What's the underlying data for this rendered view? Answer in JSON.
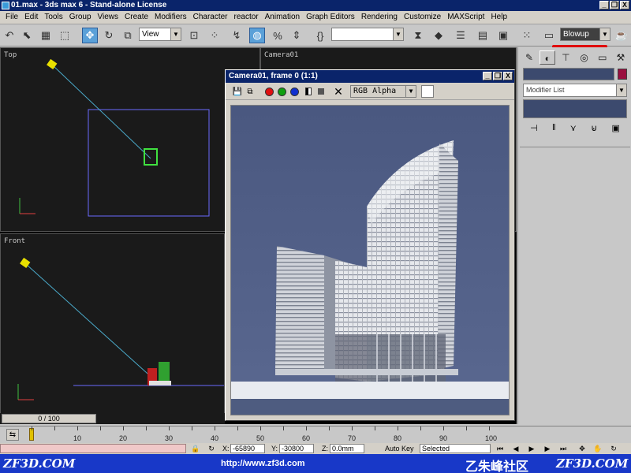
{
  "window": {
    "title": "01.max - 3ds max 6 - Stand-alone License",
    "minimize": "_",
    "restore": "❐",
    "close": "X"
  },
  "menu": [
    "File",
    "Edit",
    "Tools",
    "Group",
    "Views",
    "Create",
    "Modifiers",
    "Character",
    "reactor",
    "Animation",
    "Graph Editors",
    "Rendering",
    "Customize",
    "MAXScript",
    "Help"
  ],
  "toolbar": {
    "reference_coord": "View",
    "selection_set": "",
    "render_type": "Blowup"
  },
  "viewports": {
    "top_label": "Top",
    "front_label": "Front",
    "camera_label": "Camera01"
  },
  "render_window": {
    "title": "Camera01, frame 0 (1:1)",
    "channel": "RGB Alpha",
    "clear": "✕",
    "minimize": "_",
    "restore": "❐",
    "close": "X"
  },
  "command_panel": {
    "modifier_list": "Modifier List"
  },
  "timeline": {
    "frame_display": "0 / 100",
    "current_frame": 0,
    "ticks": [
      "10",
      "20",
      "30",
      "40",
      "50",
      "60",
      "70",
      "80",
      "90",
      "100"
    ]
  },
  "status": {
    "x_label": "X:",
    "x_value": "-65890",
    "y_label": "Y:",
    "y_value": "-30800",
    "z_label": "Z:",
    "z_value": "0.0mm",
    "autokey": "Auto Key",
    "selected": "Selected"
  },
  "banner": {
    "left": "ZF3D.COM",
    "url": "http://www.zf3d.com",
    "cn": "乙朱峰社区",
    "right": "ZF3D.COM"
  },
  "colors": {
    "title_bar": "#0a246a",
    "viewport_bg": "#1a1a1a",
    "render_bg": "#4e5c80",
    "active_tool": "#5aa0d8",
    "banner": "#1838c8"
  }
}
